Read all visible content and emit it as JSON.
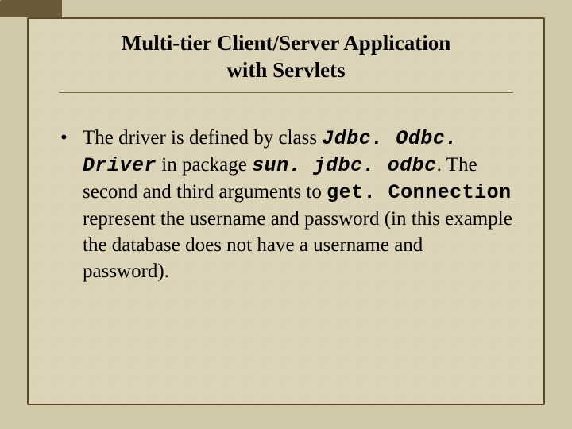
{
  "title_line1": "Multi-tier Client/Server Application",
  "title_line2": "with Servlets",
  "bullet_char": "•",
  "body": {
    "t1": "The driver is defined by class ",
    "c1": "Jdbc. Odbc. Driver",
    "t2": " in package ",
    "c2": "sun. jdbc. odbc",
    "t3": ". The second and third arguments to ",
    "c3": "get. Connection",
    "t4": " represent the username and password (in this example the database does not have a username and password)."
  }
}
